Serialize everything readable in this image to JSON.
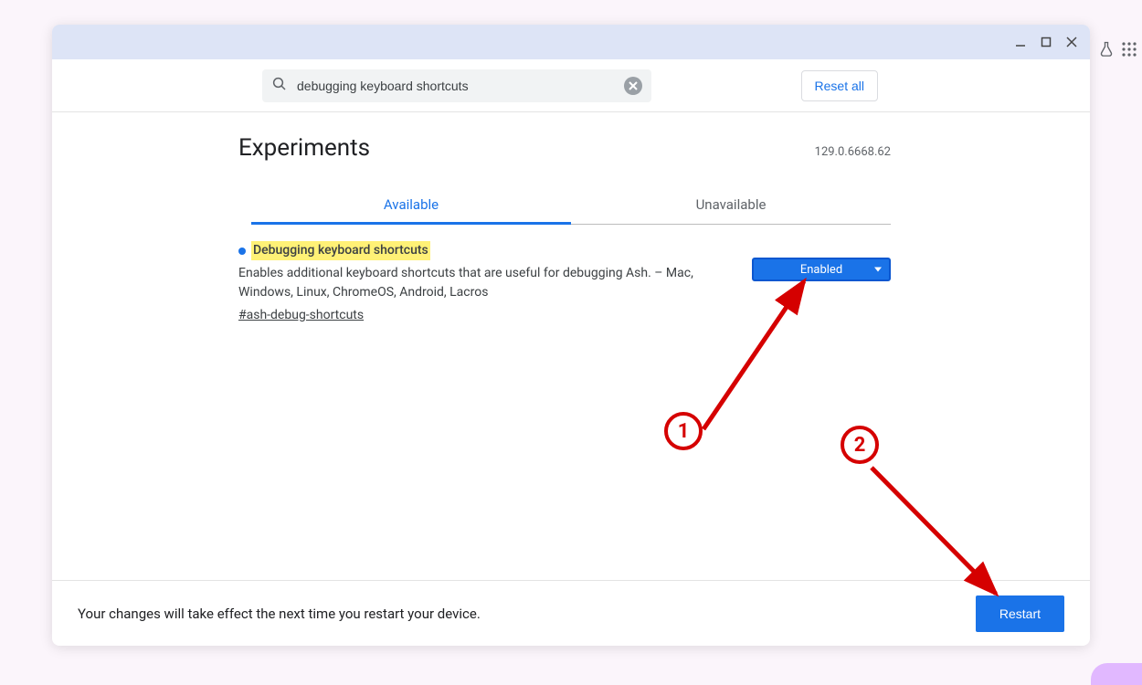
{
  "window": {
    "search_value": "debugging keyboard shortcuts",
    "reset_label": "Reset all",
    "title": "Experiments",
    "version": "129.0.6668.62",
    "tabs": {
      "available": "Available",
      "unavailable": "Unavailable"
    },
    "flag": {
      "title": "Debugging keyboard shortcuts",
      "desc": "Enables additional keyboard shortcuts that are useful for debugging Ash. – Mac, Windows, Linux, ChromeOS, Android, Lacros",
      "hash": "#ash-debug-shortcuts",
      "state": "Enabled"
    },
    "footer": {
      "msg": "Your changes will take effect the next time you restart your device.",
      "restart": "Restart"
    }
  },
  "annotations": {
    "one": "1",
    "two": "2"
  }
}
